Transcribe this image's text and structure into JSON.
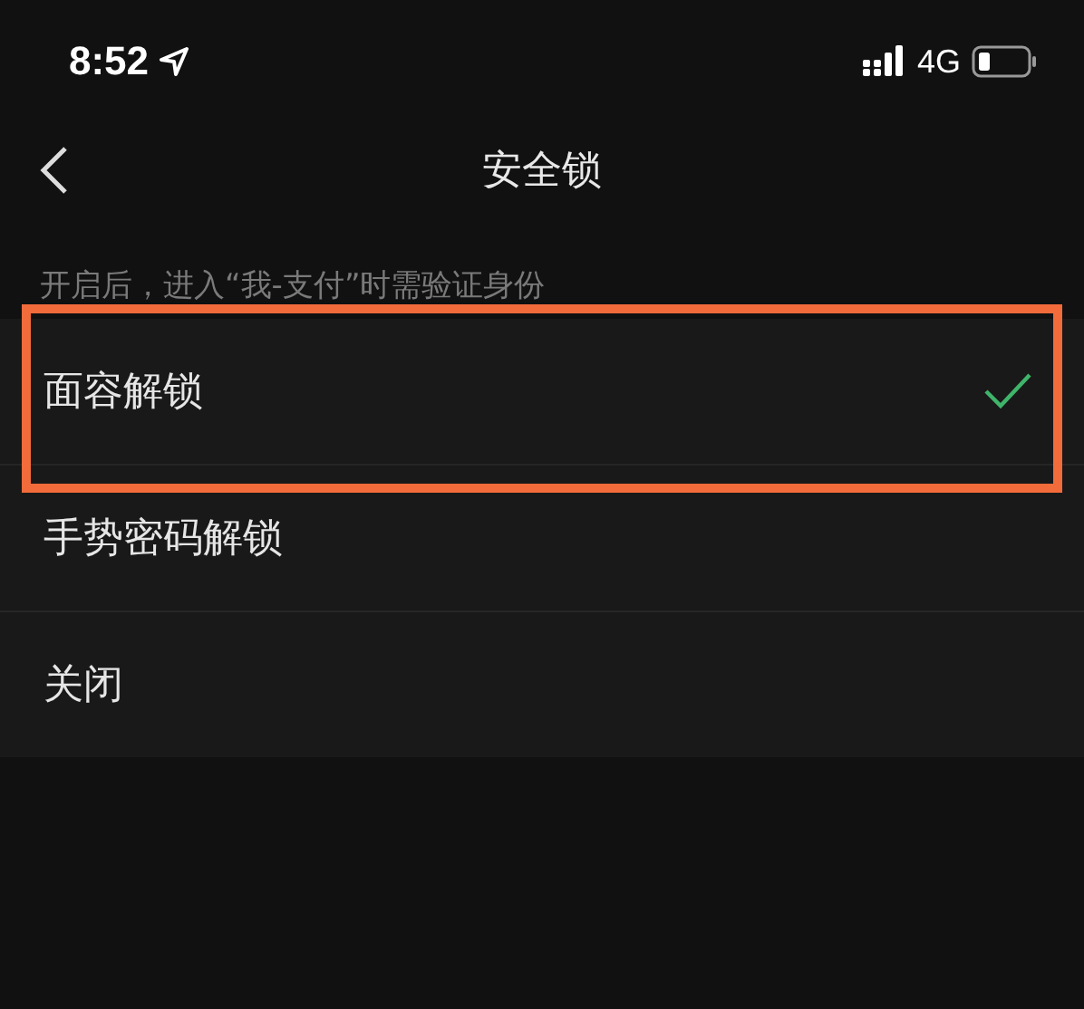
{
  "status_bar": {
    "time": "8:52",
    "network": "4G"
  },
  "nav": {
    "title": "安全锁"
  },
  "hint": "开启后，进入“我-支付”时需验证身份",
  "options": [
    {
      "label": "面容解锁",
      "selected": true,
      "highlighted": true
    },
    {
      "label": "手势密码解锁",
      "selected": false,
      "highlighted": false
    },
    {
      "label": "关闭",
      "selected": false,
      "highlighted": false
    }
  ]
}
